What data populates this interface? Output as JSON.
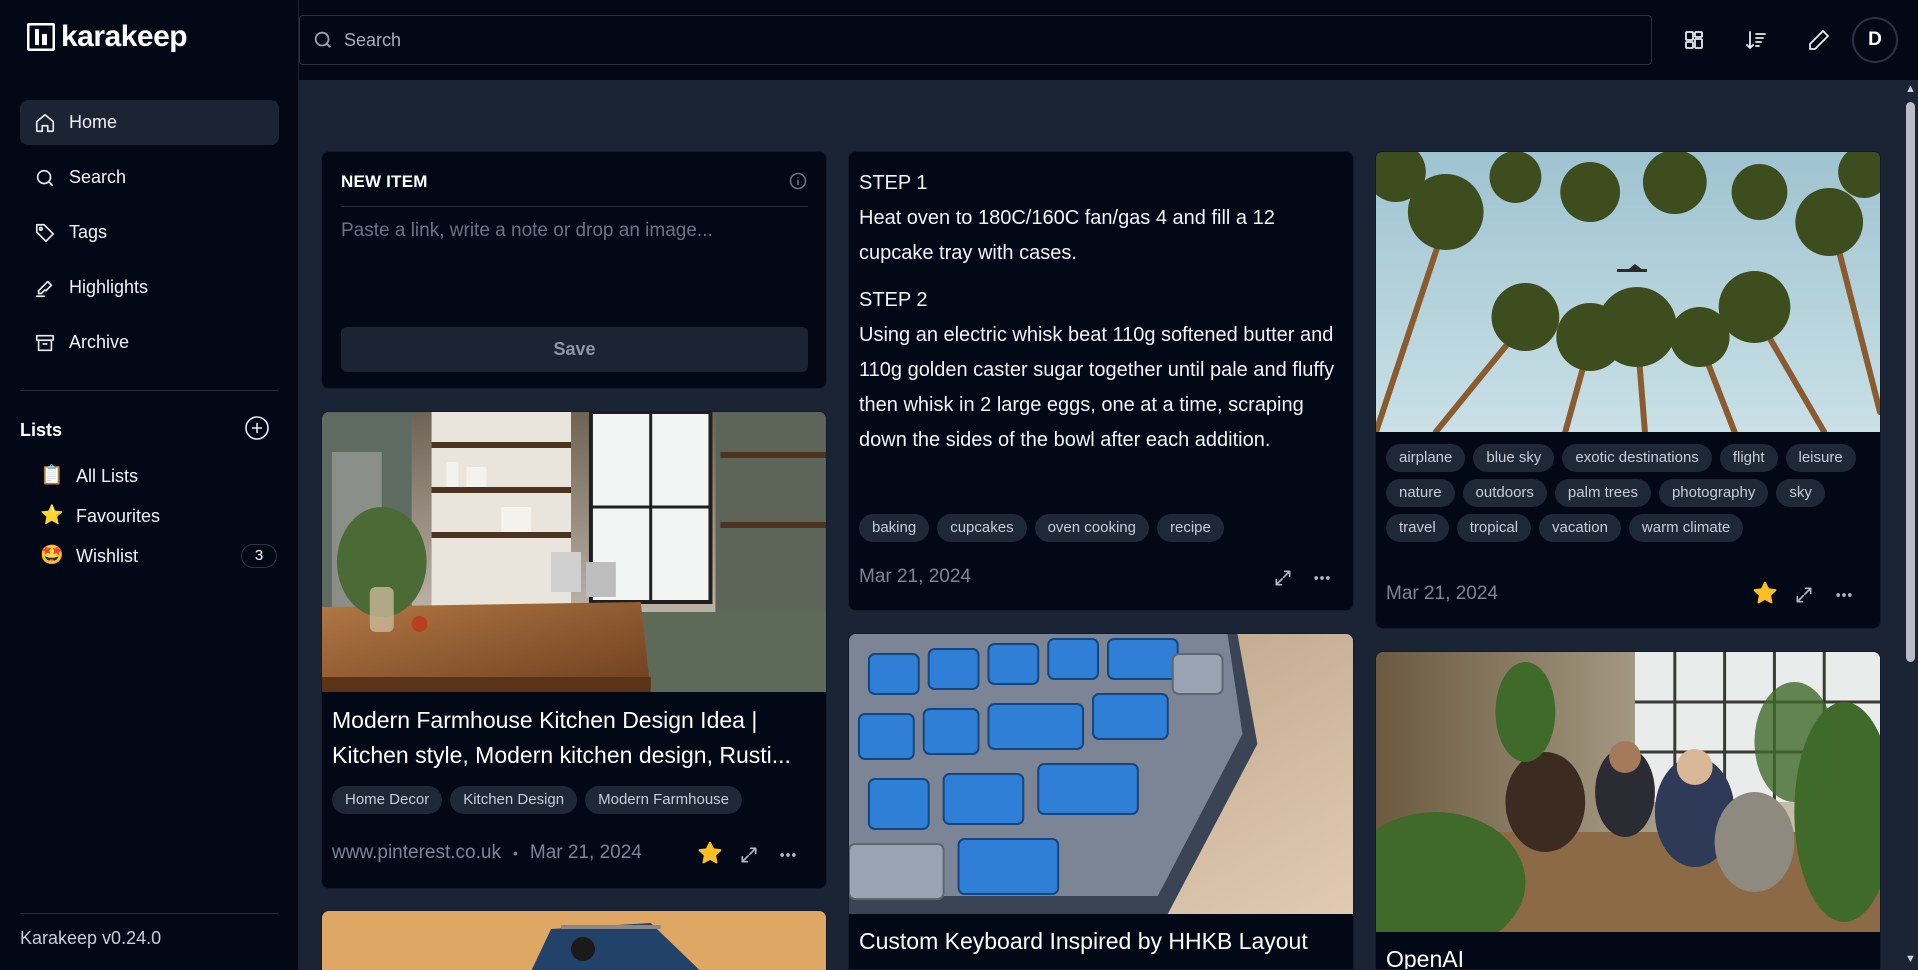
{
  "app": {
    "name": "karakeep",
    "version": "Karakeep v0.24.0"
  },
  "search": {
    "placeholder": "Search"
  },
  "user": {
    "initial": "D"
  },
  "sidebar": {
    "items": [
      {
        "label": "Home",
        "icon": "home-icon"
      },
      {
        "label": "Search",
        "icon": "search-icon"
      },
      {
        "label": "Tags",
        "icon": "tag-icon"
      },
      {
        "label": "Highlights",
        "icon": "highlighter-icon"
      },
      {
        "label": "Archive",
        "icon": "archive-icon"
      }
    ],
    "lists_title": "Lists",
    "lists": [
      {
        "label": "All Lists",
        "emoji": "📋"
      },
      {
        "label": "Favourites",
        "emoji": "⭐"
      },
      {
        "label": "Wishlist",
        "emoji": "🤩",
        "count": "3"
      }
    ]
  },
  "new_item": {
    "label": "NEW ITEM",
    "placeholder": "Paste a link, write a note or drop an image...",
    "save_label": "Save"
  },
  "cards": {
    "kitchen": {
      "title": "Modern Farmhouse Kitchen Design Idea | Kitchen style, Modern kitchen design, Rusti...",
      "tags": [
        "Home Decor",
        "Kitchen Design",
        "Modern Farmhouse"
      ],
      "source": "www.pinterest.co.uk",
      "separator": "•",
      "date": "Mar 21, 2024"
    },
    "recipe": {
      "step1_title": "STEP 1",
      "step1_text": "Heat oven to 180C/160C fan/gas 4 and fill a 12 cupcake tray with cases.",
      "step2_title": "STEP 2",
      "step2_text": "Using an electric whisk beat 110g softened butter and 110g golden caster sugar together until pale and fluffy then whisk in 2 large eggs, one at a time, scraping down the sides of the bowl after each addition.",
      "tags": [
        "baking",
        "cupcakes",
        "oven cooking",
        "recipe"
      ],
      "date": "Mar 21, 2024"
    },
    "palms": {
      "tags": [
        "airplane",
        "blue sky",
        "exotic destinations",
        "flight",
        "leisure",
        "nature",
        "outdoors",
        "palm trees",
        "photography",
        "sky",
        "travel",
        "tropical",
        "vacation",
        "warm climate"
      ],
      "date": "Mar 21, 2024"
    },
    "keyboard": {
      "title": "Custom Keyboard Inspired by HHKB Layout"
    },
    "openai": {
      "title": "OpenAI"
    }
  },
  "colors": {
    "background": "#1b2434",
    "panel": "#030817",
    "accent_star": "#fbbf24"
  }
}
